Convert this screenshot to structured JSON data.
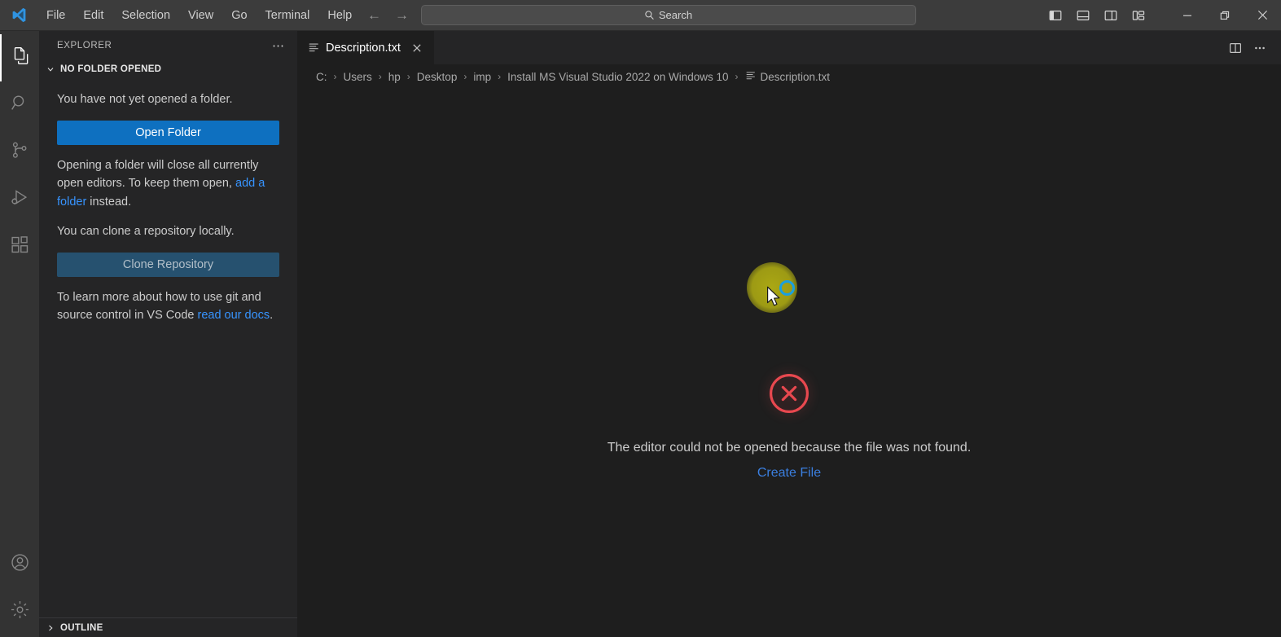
{
  "titlebar": {
    "logo_icon": "vscode-logo-icon",
    "menus": [
      "File",
      "Edit",
      "Selection",
      "View",
      "Go",
      "Terminal",
      "Help"
    ],
    "back_icon": "arrow-left-icon",
    "forward_icon": "arrow-right-icon",
    "search": {
      "placeholder": "Search",
      "value": "",
      "icon": "search-icon"
    },
    "layout_buttons": [
      {
        "name": "toggle-primary-sidebar",
        "icon": "layout-sidebar-left-icon"
      },
      {
        "name": "toggle-panel",
        "icon": "layout-panel-icon"
      },
      {
        "name": "toggle-secondary-sidebar",
        "icon": "layout-sidebar-right-icon"
      },
      {
        "name": "customize-layout",
        "icon": "layout-customize-icon"
      }
    ],
    "window_buttons": [
      {
        "name": "minimize-button",
        "icon": "minimize-icon"
      },
      {
        "name": "maximize-button",
        "icon": "maximize-restore-icon"
      },
      {
        "name": "close-button",
        "icon": "close-icon"
      }
    ]
  },
  "activitybar": {
    "items": [
      {
        "name": "explorer",
        "icon": "files-icon",
        "active": true
      },
      {
        "name": "search",
        "icon": "search-icon",
        "active": false
      },
      {
        "name": "source-control",
        "icon": "source-control-icon",
        "active": false
      },
      {
        "name": "run-and-debug",
        "icon": "run-debug-icon",
        "active": false
      },
      {
        "name": "extensions",
        "icon": "extensions-icon",
        "active": false
      }
    ],
    "bottom_items": [
      {
        "name": "accounts",
        "icon": "account-icon"
      },
      {
        "name": "manage-settings",
        "icon": "gear-icon"
      }
    ]
  },
  "sidebar": {
    "title": "EXPLORER",
    "more_actions_icon": "ellipsis-icon",
    "section": {
      "label": "NO FOLDER OPENED",
      "chevron_icon": "chevron-down-icon",
      "no_folder_text": "You have not yet opened a folder.",
      "open_folder_button": "Open Folder",
      "opening_text_before": "Opening a folder will close all currently open editors. To keep them open, ",
      "opening_link": "add a folder",
      "opening_text_after": " instead.",
      "clone_text": "You can clone a repository locally.",
      "clone_button": "Clone Repository",
      "learn_text_before": "To learn more about how to use git and source control in VS Code ",
      "learn_link": "read our docs",
      "learn_text_after": "."
    },
    "outline": {
      "label": "OUTLINE",
      "chevron_icon": "chevron-right-icon"
    }
  },
  "editor": {
    "tab": {
      "label": "Description.txt",
      "file_icon": "text-file-icon",
      "close_icon": "close-icon",
      "active": true
    },
    "tab_actions": [
      {
        "name": "split-editor-right",
        "icon": "split-editor-icon"
      },
      {
        "name": "more-editor-actions",
        "icon": "ellipsis-icon"
      }
    ],
    "breadcrumbs": [
      "C:",
      "Users",
      "hp",
      "Desktop",
      "imp",
      "Install MS Visual Studio 2022 on Windows 10"
    ],
    "breadcrumb_file": "Description.txt",
    "breadcrumb_file_icon": "text-file-icon",
    "breadcrumb_separator": "›",
    "error": {
      "icon": "error-circle-x-icon",
      "message": "The editor could not be opened because the file was not found.",
      "action_link": "Create File"
    }
  },
  "cursor": {
    "click_highlight": "click-halo",
    "loading_ring": "loading-spinner-icon",
    "pointer": "mouse-pointer-icon"
  },
  "colors": {
    "titlebar_bg": "#3c3c3c",
    "activitybar_bg": "#333333",
    "sidebar_bg": "#252526",
    "editor_bg": "#1e1e1e",
    "accent_blue": "#0e70c0",
    "link_blue": "#3794ff",
    "error_red": "#e8484f",
    "highlight_yellow": "#afac14"
  }
}
